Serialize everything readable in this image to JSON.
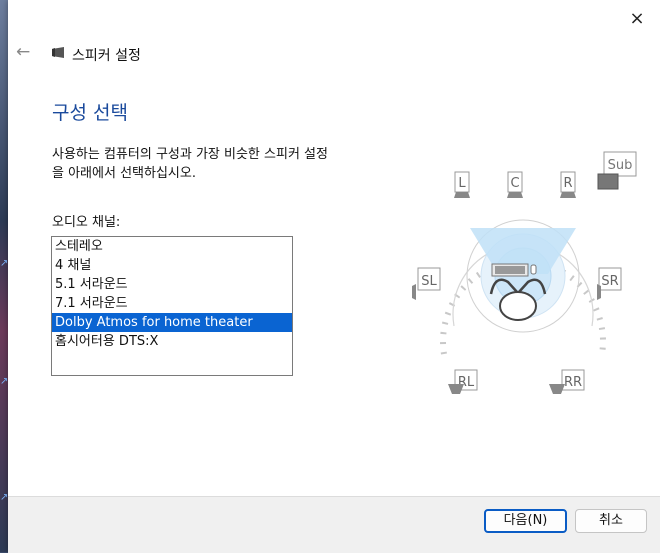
{
  "window": {
    "title": "스피커 설정",
    "close_icon": "×",
    "back_icon": "←"
  },
  "page": {
    "heading": "구성 선택",
    "description": "사용하는 컴퓨터의 구성과 가장 비슷한 스피커 설정\n을 아래에서 선택하십시오.",
    "list_label": "오디오 채널:"
  },
  "channels": [
    {
      "label": "스테레오",
      "selected": false
    },
    {
      "label": "4 채널",
      "selected": false
    },
    {
      "label": "5.1 서라운드",
      "selected": false
    },
    {
      "label": "7.1 서라운드",
      "selected": false
    },
    {
      "label": "Dolby Atmos for home theater",
      "selected": true
    },
    {
      "label": "홈시어터용 DTS:X",
      "selected": false
    }
  ],
  "speakers": {
    "front_left": "L",
    "center": "C",
    "front_right": "R",
    "subwoofer": "Sub",
    "side_left": "SL",
    "side_right": "SR",
    "rear_left": "RL",
    "rear_right": "RR"
  },
  "buttons": {
    "next": "다음(N)",
    "cancel": "취소"
  },
  "colors": {
    "accent": "#0a64d2",
    "heading": "#1a4a9c"
  }
}
